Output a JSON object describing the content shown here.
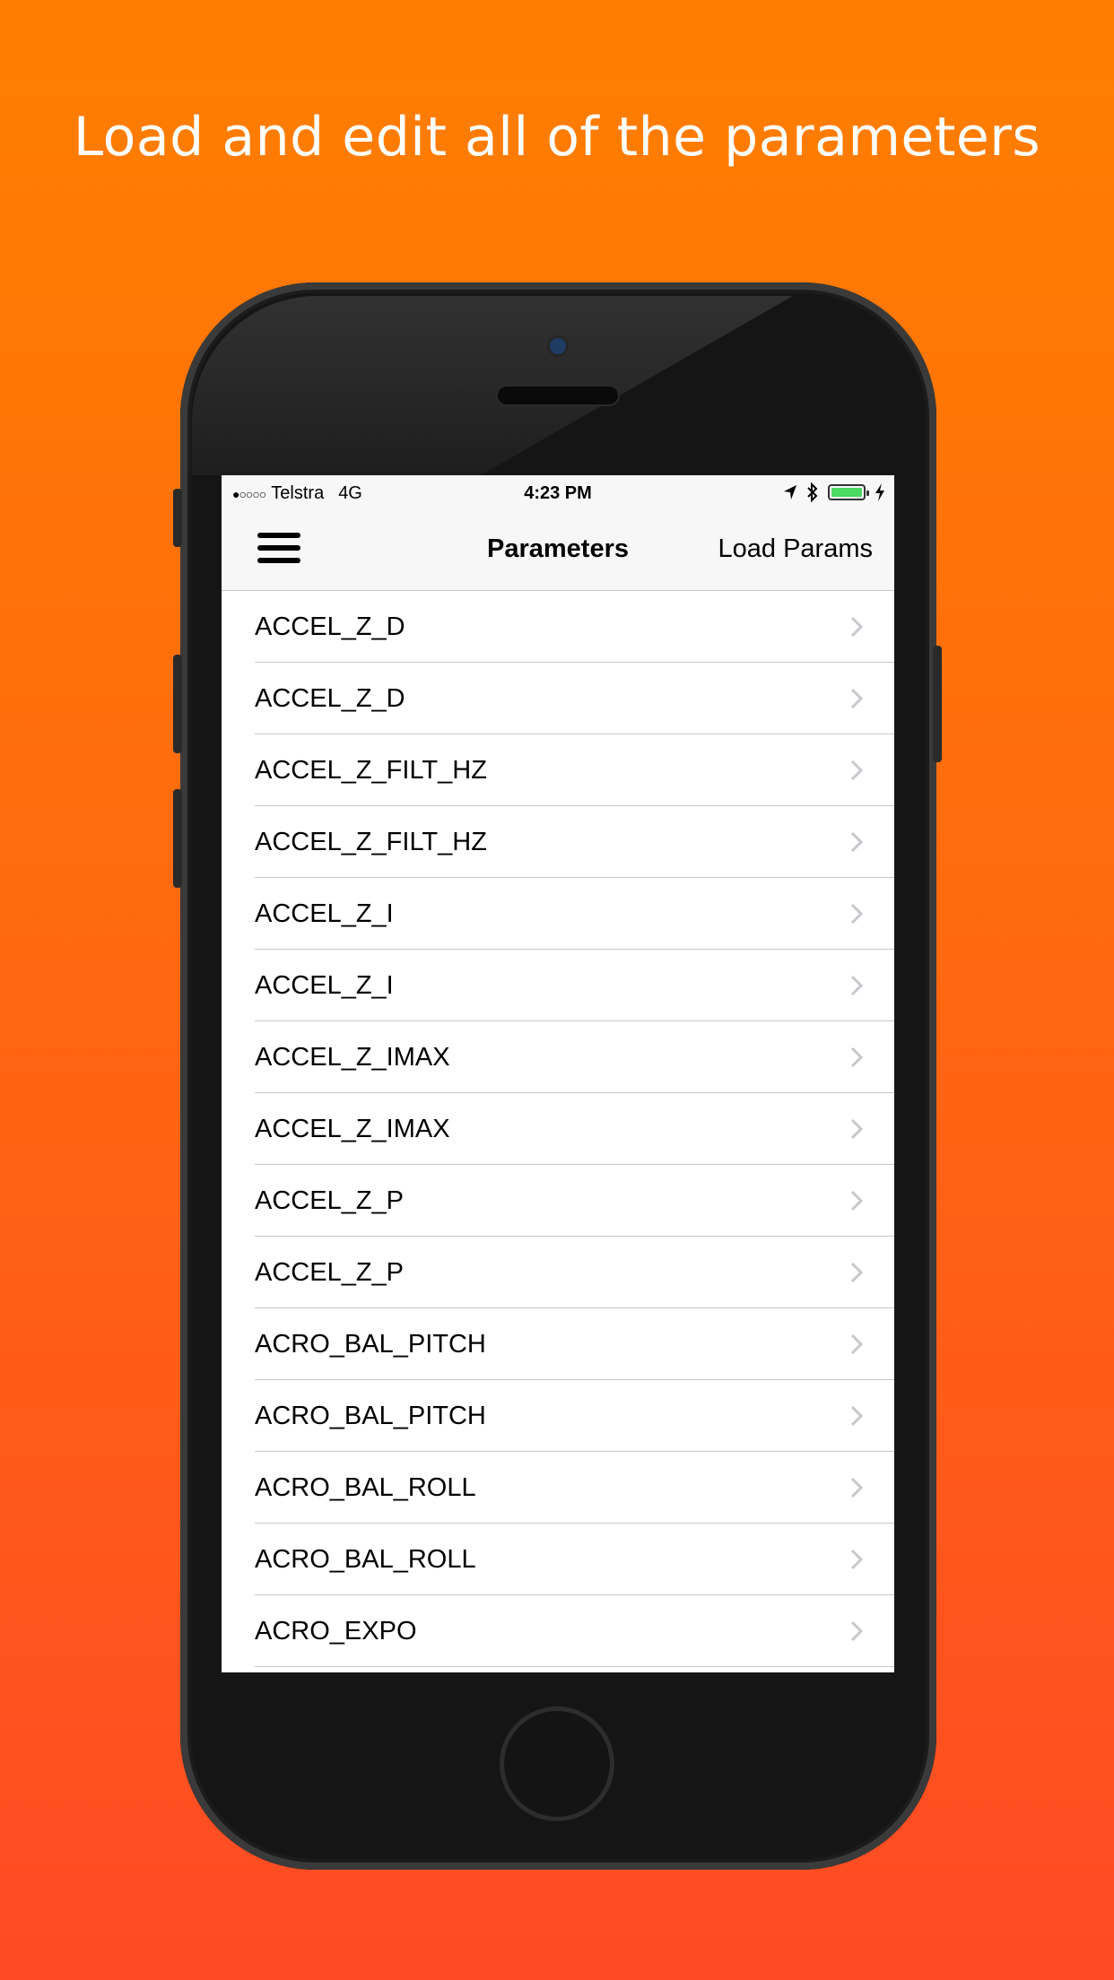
{
  "headline": "Load and edit all of the parameters",
  "status_bar": {
    "signal_dots": "●○○○○",
    "carrier": "Telstra",
    "network": "4G",
    "time": "4:23 PM",
    "icons": [
      "location-arrow-icon",
      "bluetooth-icon",
      "battery-icon",
      "charging-bolt-icon"
    ]
  },
  "navbar": {
    "menu_icon": "hamburger-menu-icon",
    "title": "Parameters",
    "right_button": "Load Params"
  },
  "parameters": [
    "ACCEL_Z_D",
    "ACCEL_Z_D",
    "ACCEL_Z_FILT_HZ",
    "ACCEL_Z_FILT_HZ",
    "ACCEL_Z_I",
    "ACCEL_Z_I",
    "ACCEL_Z_IMAX",
    "ACCEL_Z_IMAX",
    "ACCEL_Z_P",
    "ACCEL_Z_P",
    "ACRO_BAL_PITCH",
    "ACRO_BAL_PITCH",
    "ACRO_BAL_ROLL",
    "ACRO_BAL_ROLL",
    "ACRO_EXPO"
  ],
  "colors": {
    "background_top": "#ff7f00",
    "background_bottom": "#ff4a25",
    "battery": "#4cd964"
  }
}
